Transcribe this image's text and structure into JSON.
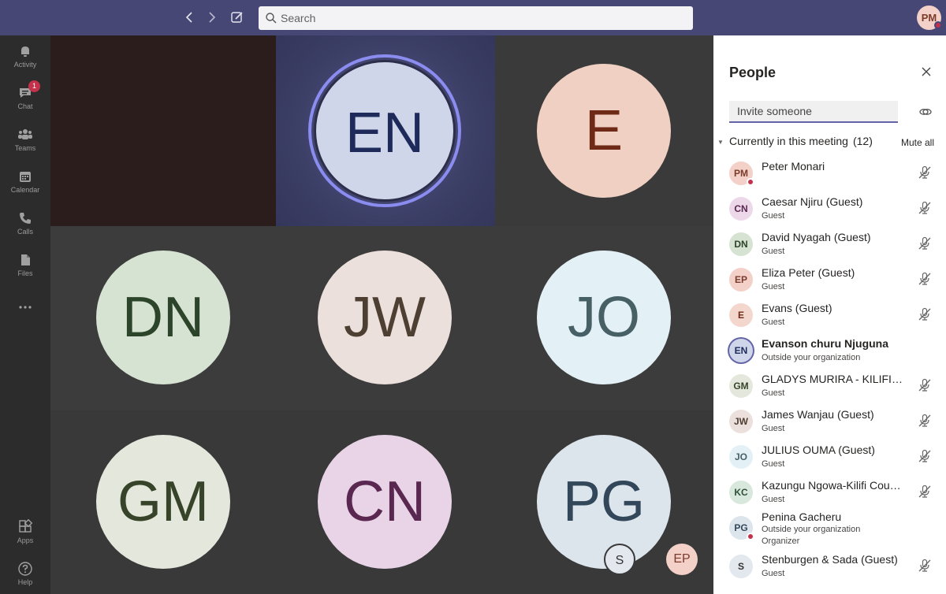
{
  "topbar": {
    "search_placeholder": "Search",
    "user_initials": "PM"
  },
  "rail": {
    "items": [
      {
        "label": "Activity",
        "icon": "bell-icon"
      },
      {
        "label": "Chat",
        "icon": "chat-icon",
        "badge": "1"
      },
      {
        "label": "Teams",
        "icon": "teams-icon"
      },
      {
        "label": "Calendar",
        "icon": "calendar-icon"
      },
      {
        "label": "Calls",
        "icon": "phone-icon"
      },
      {
        "label": "Files",
        "icon": "file-icon"
      }
    ],
    "bottom_items": [
      {
        "label": "Apps",
        "icon": "apps-icon"
      },
      {
        "label": "Help",
        "icon": "help-icon"
      }
    ]
  },
  "stage": {
    "tiles": [
      {
        "initials": "",
        "bg": "#2a1d1c",
        "avatar_bg": "",
        "avatar_fg": ""
      },
      {
        "initials": "EN",
        "bg": "#40436a",
        "avatar_bg": "#cfd6ea",
        "avatar_fg": "#1e2b5a",
        "speaking": true
      },
      {
        "initials": "E",
        "bg": "#3a3a3a",
        "avatar_bg": "#f0d0c2",
        "avatar_fg": "#6e2a16"
      },
      {
        "initials": "DN",
        "bg": "#3b3b3b",
        "avatar_bg": "#d6e3d2",
        "avatar_fg": "#2c4429"
      },
      {
        "initials": "JW",
        "bg": "#3b3b3b",
        "avatar_bg": "#ece0dc",
        "avatar_fg": "#4e3f33"
      },
      {
        "initials": "JO",
        "bg": "#3b3b3b",
        "avatar_bg": "#e3f1f6",
        "avatar_fg": "#476066"
      },
      {
        "initials": "GM",
        "bg": "#383838",
        "avatar_bg": "#e4e8dc",
        "avatar_fg": "#37442a"
      },
      {
        "initials": "CN",
        "bg": "#383838",
        "avatar_bg": "#e8d4e6",
        "avatar_fg": "#5a2750"
      },
      {
        "initials": "PG",
        "bg": "#383838",
        "avatar_bg": "#dce4ec",
        "avatar_fg": "#33475a"
      }
    ],
    "overflow": [
      {
        "initials": "S",
        "bg": "#e3e7ee",
        "fg": "#333"
      },
      {
        "initials": "EP",
        "bg": "#f3d1c8",
        "fg": "#7a3b2b"
      }
    ]
  },
  "panel": {
    "title": "People",
    "invite_placeholder": "Invite someone",
    "section_label": "Currently in this meeting",
    "section_count": "(12)",
    "mute_all": "Mute all",
    "people": [
      {
        "initials": "PM",
        "name": "Peter Monari",
        "role": "",
        "role2": "",
        "bg": "#f3d1c8",
        "fg": "#7a3b2b",
        "dot": true,
        "bold": false,
        "mic": true
      },
      {
        "initials": "CN",
        "name": "Caesar Njiru (Guest)",
        "role": "Guest",
        "role2": "",
        "bg": "#ecd8e9",
        "fg": "#5a2750",
        "dot": false,
        "bold": false,
        "mic": true
      },
      {
        "initials": "DN",
        "name": "David Nyagah (Guest)",
        "role": "Guest",
        "role2": "",
        "bg": "#d6e3d2",
        "fg": "#2c4429",
        "dot": false,
        "bold": false,
        "mic": true
      },
      {
        "initials": "EP",
        "name": "Eliza Peter (Guest)",
        "role": "Guest",
        "role2": "",
        "bg": "#f3d1c8",
        "fg": "#7a3b2b",
        "dot": false,
        "bold": false,
        "mic": true
      },
      {
        "initials": "E",
        "name": "Evans (Guest)",
        "role": "Guest",
        "role2": "",
        "bg": "#f3d7cc",
        "fg": "#6e2a16",
        "dot": false,
        "bold": false,
        "mic": true
      },
      {
        "initials": "EN",
        "name": "Evanson churu Njuguna",
        "role": "Outside your organization",
        "role2": "",
        "bg": "#cfd6ea",
        "fg": "#1e2b5a",
        "dot": false,
        "bold": true,
        "mic": false,
        "ring": true
      },
      {
        "initials": "GM",
        "name": "GLADYS MURIRA - KILIFI COUNTY",
        "role": "Guest",
        "role2": "",
        "bg": "#e4e8dc",
        "fg": "#37442a",
        "dot": false,
        "bold": false,
        "mic": true
      },
      {
        "initials": "JW",
        "name": "James Wanjau (Guest)",
        "role": "Guest",
        "role2": "",
        "bg": "#ece0dc",
        "fg": "#4e3f33",
        "dot": false,
        "bold": false,
        "mic": true
      },
      {
        "initials": "JO",
        "name": "JULIUS OUMA (Guest)",
        "role": "Guest",
        "role2": "",
        "bg": "#e3f1f6",
        "fg": "#476066",
        "dot": false,
        "bold": false,
        "mic": true
      },
      {
        "initials": "KC",
        "name": "Kazungu Ngowa-Kilifi County",
        "role": "Guest",
        "role2": "",
        "bg": "#d9e8dd",
        "fg": "#2f5038",
        "dot": false,
        "bold": false,
        "mic": true
      },
      {
        "initials": "PG",
        "name": "Penina Gacheru",
        "role": "Outside your organization",
        "role2": "Organizer",
        "bg": "#dce4ec",
        "fg": "#33475a",
        "dot": true,
        "bold": false,
        "mic": false
      },
      {
        "initials": "S",
        "name": "Stenburgen & Sada (Guest)",
        "role": "Guest",
        "role2": "",
        "bg": "#e3e7ee",
        "fg": "#333",
        "dot": false,
        "bold": false,
        "mic": true
      }
    ]
  }
}
